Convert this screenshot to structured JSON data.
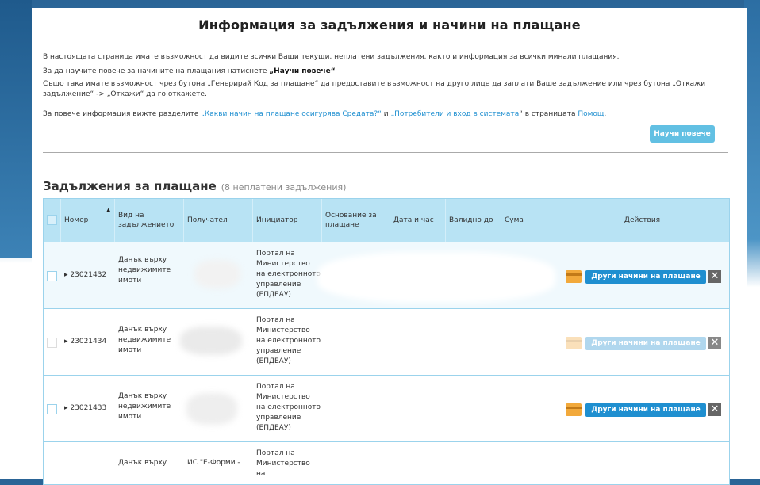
{
  "page": {
    "title": "Информация за задължения и начини на плащане",
    "para1": "В настоящата страница имате възможност да видите всички Ваши текущи, неплатени задължения, както и информация за всички минали плащания.",
    "para2_prefix": "За да научите повече за начините на плащания натиснете ",
    "para2_bold": "„Научи повече“",
    "para3": "Също така имате възможност чрез бутона „Генерирай Код за плащане“ да предоставите възможност на друго лице да заплати Ваше задължение или чрез бутона „Откажи задължение“ -> „Откажи“ да го откажете.",
    "para4_prefix": "За повече информация вижте разделите ",
    "para4_link1": "„Какви начин на плащане осигурява Средата?“",
    "para4_mid": " и ",
    "para4_link2": "„Потребители и вход в системата",
    "para4_mid2": "“ в страницата ",
    "para4_link3": "Помощ",
    "para4_suffix": ".",
    "learn_more_button": "Научи повече"
  },
  "section": {
    "title": "Задължения за плащане",
    "subtitle": "(8 неплатени задължения)"
  },
  "table": {
    "headers": {
      "number": "Номер",
      "type": "Вид на задължението",
      "recipient": "Получател",
      "initiator": "Инициатор",
      "basis": "Основание за плащане",
      "datetime": "Дата и час",
      "valid_until": "Валидно до",
      "amount": "Сума",
      "actions": "Действия"
    },
    "rows": [
      {
        "number": "23021432",
        "type": "Данък върху недвижимите имоти",
        "initiator": "Портал на Министерство на електронното управление (ЕПДЕАУ)",
        "pay_label": "Други начини на плащане"
      },
      {
        "number": "23021434",
        "type": "Данък върху недвижимите имоти",
        "initiator": "Портал на Министерство на електронното управление (ЕПДЕАУ)",
        "pay_label": "Други начини на плащане"
      },
      {
        "number": "23021433",
        "type": "Данък върху недвижимите имоти",
        "initiator": "Портал на Министерство на електронното управление (ЕПДЕАУ)",
        "pay_label": "Други начини на плащане"
      },
      {
        "type": "Данък върху",
        "recipient": "ИС \"Е-Форми -",
        "initiator": "Портал на Министерство на"
      }
    ]
  }
}
